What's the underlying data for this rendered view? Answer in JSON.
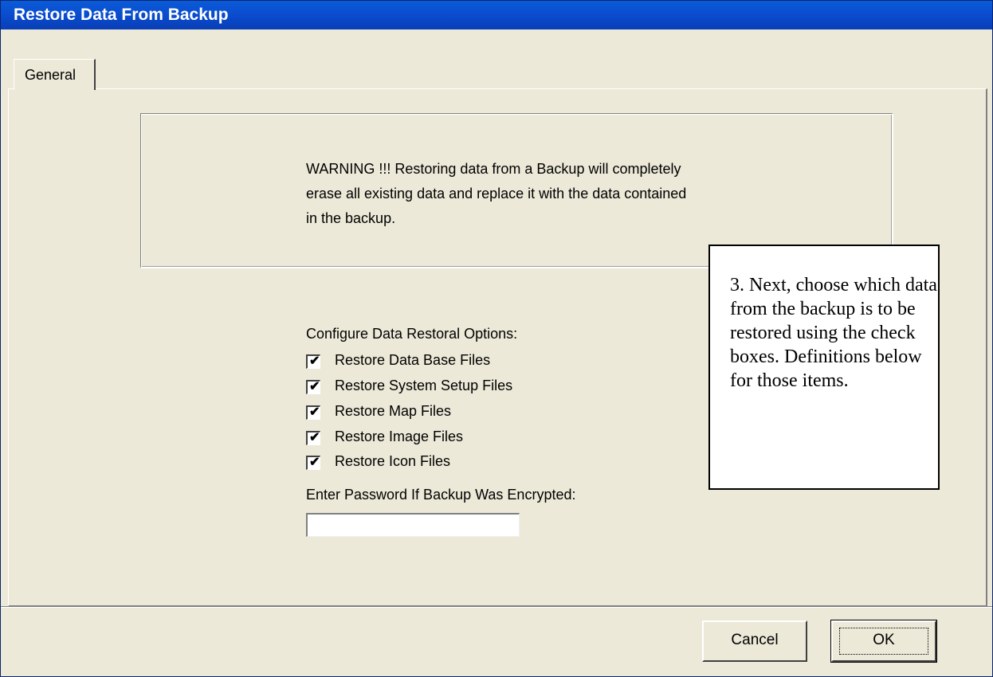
{
  "window": {
    "title": "Restore Data From Backup"
  },
  "tabs": [
    {
      "label": "General",
      "selected": true
    }
  ],
  "warning": {
    "text": "WARNING !!! Restoring data from a Backup will completely erase all existing data and replace it with the data contained in the backup."
  },
  "options": {
    "label": "Configure Data Restoral Options:",
    "items": [
      {
        "label": "Restore Data Base Files",
        "checked": true
      },
      {
        "label": "Restore System Setup Files",
        "checked": true
      },
      {
        "label": "Restore Map Files",
        "checked": true
      },
      {
        "label": "Restore Image Files",
        "checked": true
      },
      {
        "label": "Restore Icon Files",
        "checked": true
      }
    ]
  },
  "password": {
    "label": "Enter Password If Backup Was Encrypted:",
    "value": ""
  },
  "callout": {
    "text": "3. Next, choose which data from the backup is to be restored using the check boxes. Definitions below for those items."
  },
  "buttons": {
    "cancel_label": "Cancel",
    "ok_label": "OK"
  },
  "colors": {
    "titlebar": "#0a4fd0",
    "dialog_bg": "#ece9d8"
  }
}
